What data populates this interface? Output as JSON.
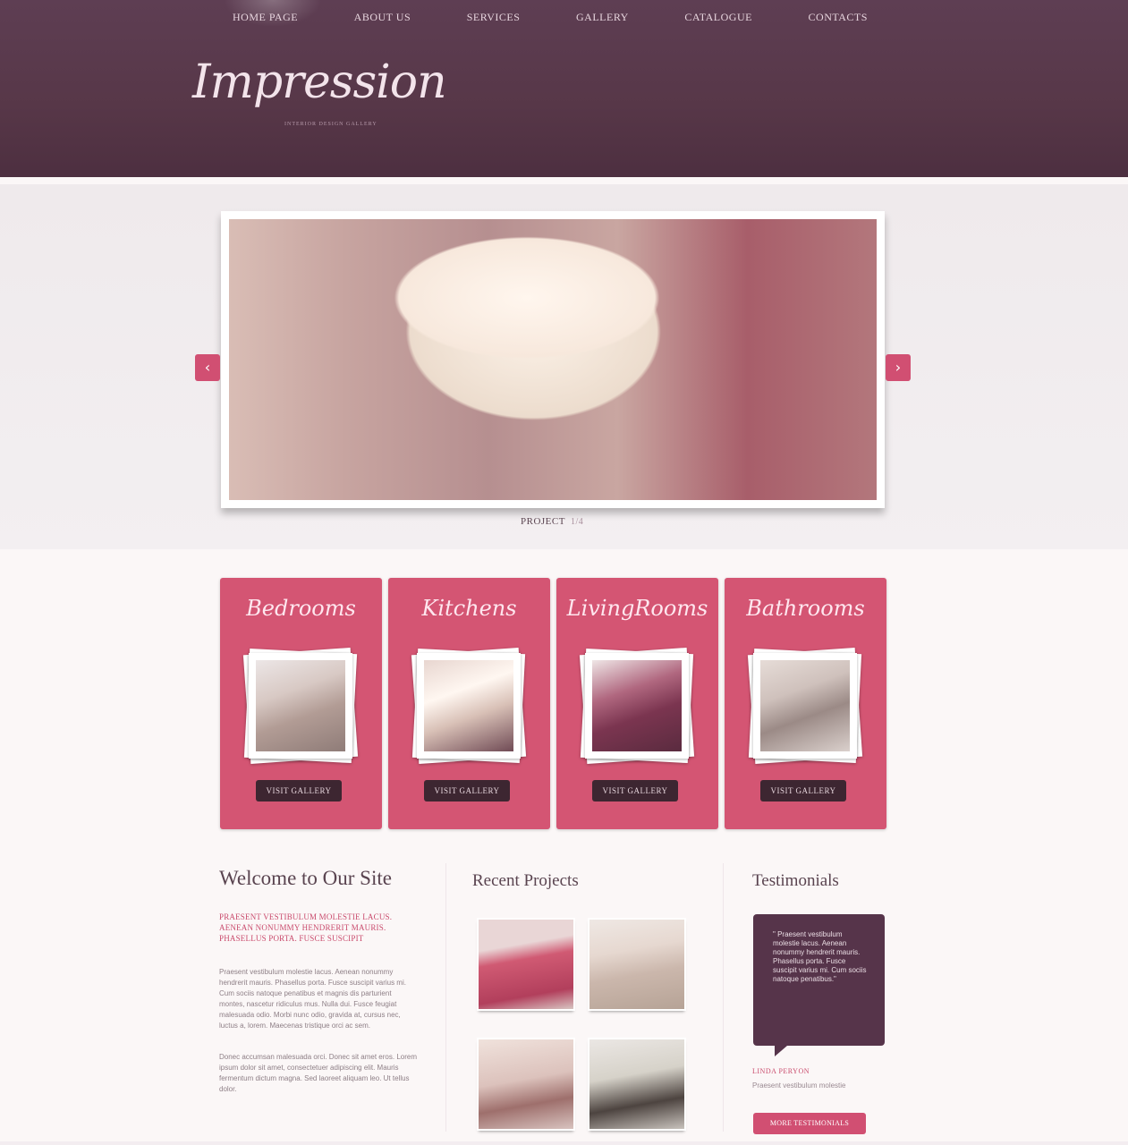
{
  "nav": {
    "items": [
      {
        "label": "HOME PAGE"
      },
      {
        "label": "ABOUT US"
      },
      {
        "label": "SERVICES"
      },
      {
        "label": "GALLERY"
      },
      {
        "label": "CATALOGUE"
      },
      {
        "label": "CONTACTS"
      }
    ]
  },
  "brand": {
    "logo": "Impression",
    "tagline": "INTERIOR DESIGN GALLERY"
  },
  "slider": {
    "caption_label": "PROJECT",
    "caption_number": "1/4",
    "prev_icon": "chevron-left",
    "next_icon": "chevron-right"
  },
  "categories": [
    {
      "title": "Bedrooms",
      "button": "VISIT GALLERY"
    },
    {
      "title": "Kitchens",
      "button": "VISIT GALLERY"
    },
    {
      "title": "LivingRooms",
      "button": "VISIT GALLERY"
    },
    {
      "title": "Bathrooms",
      "button": "VISIT GALLERY"
    }
  ],
  "welcome": {
    "heading": "Welcome to Our Site",
    "intro": "PRAESENT VESTIBULUM MOLESTIE LACUS. AENEAN NONUMMY HENDRERIT MAURIS. PHASELLUS PORTA. FUSCE SUSCIPIT",
    "paragraph1": "Praesent vestibulum molestie lacus. Aenean nonummy hendrerit mauris. Phasellus porta. Fusce suscipit varius mi. Cum sociis natoque penatibus et magnis dis parturient montes, nascetur ridiculus mus. Nulla dui. Fusce feugiat malesuada odio. Morbi nunc odio, gravida at, cursus nec, luctus a, lorem. Maecenas tristique orci ac sem.",
    "paragraph2": "Donec accumsan malesuada orci. Donec sit amet eros. Lorem ipsum dolor sit amet, consectetuer adipiscing elit. Mauris fermentum dictum magna. Sed laoreet aliquam leo. Ut tellus dolor."
  },
  "recent": {
    "heading": "Recent Projects"
  },
  "testimonials": {
    "heading": "Testimonials",
    "quote": "\" Praesent vestibulum molestie lacus. Aenean nonummy hendrerit mauris. Phasellus porta. Fusce suscipit varius mi. Cum sociis natoque penatibus.\"",
    "name": "LINDA PERYON",
    "role": "Praesent vestibulum molestie",
    "button": "MORE TESTIMONIALS"
  },
  "colors": {
    "header": "#573748",
    "accent": "#d45573",
    "dark_button": "#3d2631"
  }
}
